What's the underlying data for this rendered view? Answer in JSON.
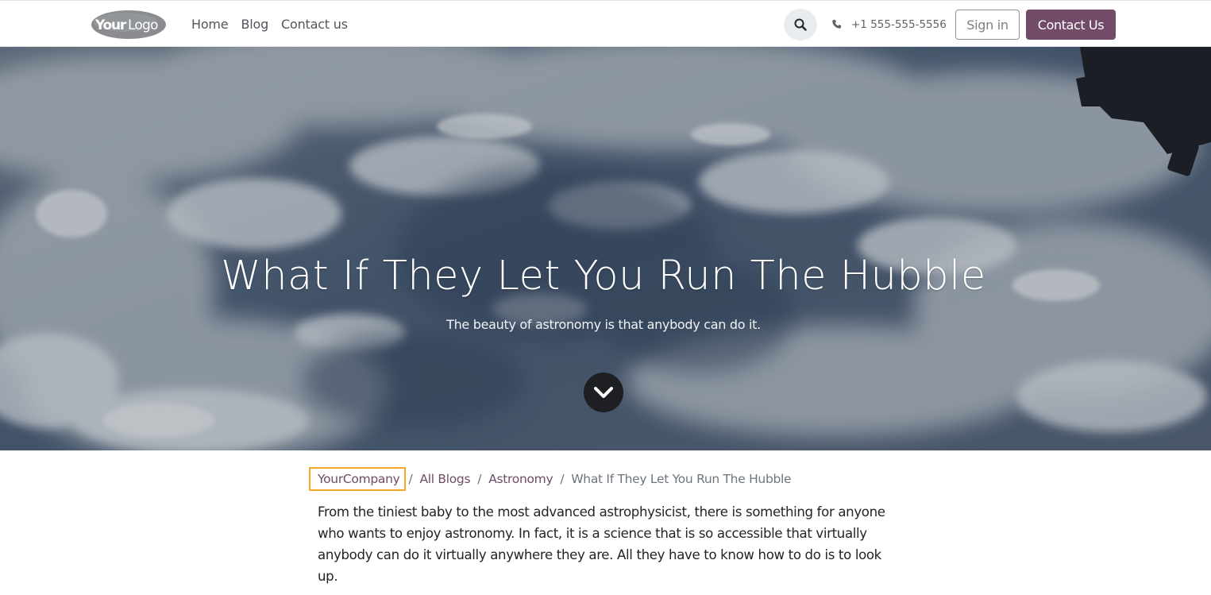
{
  "header": {
    "logo_text_your": "Your",
    "logo_text_logo": "Logo",
    "nav": [
      {
        "label": "Home"
      },
      {
        "label": "Blog"
      },
      {
        "label": "Contact us"
      }
    ],
    "search_icon": "search-icon",
    "phone_icon": "phone-icon",
    "phone": "+1 555-555-5556",
    "signin_label": "Sign in",
    "contact_label": "Contact Us",
    "accent_color": "#714b67"
  },
  "hero": {
    "title": "What If They Let You Run The Hubble",
    "subtitle": "The beauty of astronomy is that anybody can do it.",
    "scroll_icon": "chevron-down-icon"
  },
  "breadcrumb": {
    "items": [
      {
        "label": "YourCompany"
      },
      {
        "label": "All Blogs"
      },
      {
        "label": "Astronomy"
      },
      {
        "label": "What If They Let You Run The Hubble"
      }
    ],
    "separator": "/"
  },
  "article": {
    "paragraph": "From the tiniest baby to the most advanced astrophysicist, there is something for anyone who wants to enjoy astronomy. In fact, it is a science that is so accessible that virtually anybody can do it virtually anywhere they are. All they have to know how to do is to look up."
  }
}
